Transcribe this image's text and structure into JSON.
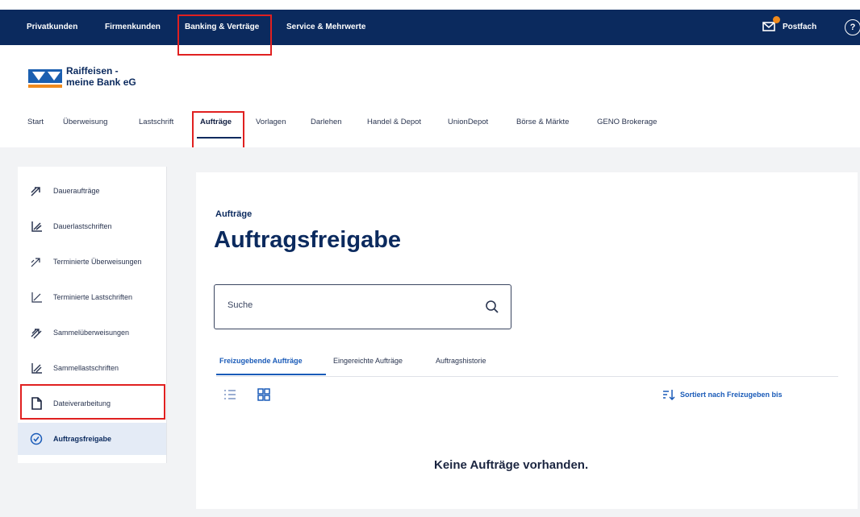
{
  "topnav": {
    "items": [
      "Privatkunden",
      "Firmenkunden",
      "Banking & Verträge",
      "Service & Mehrwerte"
    ],
    "postfach_label": "Postfach",
    "help_symbol": "?"
  },
  "logo": {
    "line1": "Raiffeisen -",
    "line2": "meine Bank eG",
    "icon": "volksbank-raiffeisen-logo"
  },
  "subnav": {
    "items": [
      "Start",
      "Überweisung",
      "Lastschrift",
      "Aufträge",
      "Vorlagen",
      "Darlehen",
      "Handel & Depot",
      "UnionDepot",
      "Börse & Märkte",
      "GENO Brokerage"
    ],
    "active": "Aufträge"
  },
  "sidebar": {
    "items": [
      {
        "label": "Daueraufträge",
        "icon": "standing-order-icon"
      },
      {
        "label": "Dauerlastschriften",
        "icon": "standing-debit-icon"
      },
      {
        "label": "Terminierte Überweisungen",
        "icon": "scheduled-transfer-icon"
      },
      {
        "label": "Terminierte Lastschriften",
        "icon": "scheduled-debit-icon"
      },
      {
        "label": "Sammelüberweisungen",
        "icon": "batch-transfer-icon"
      },
      {
        "label": "Sammellastschriften",
        "icon": "batch-debit-icon"
      },
      {
        "label": "Dateiverarbeitung",
        "icon": "file-icon"
      },
      {
        "label": "Auftragsfreigabe",
        "icon": "check-circle-icon"
      }
    ],
    "active": "Auftragsfreigabe"
  },
  "main": {
    "breadcrumb": "Aufträge",
    "title": "Auftragsfreigabe",
    "search": {
      "placeholder": "Suche",
      "icon": "search-icon"
    },
    "tabs": [
      "Freizugebende Aufträge",
      "Eingereichte Aufträge",
      "Auftragshistorie"
    ],
    "active_tab": "Freizugebende Aufträge",
    "sort_label": "Sortiert nach Freizugeben bis",
    "empty_message": "Keine Aufträge vorhanden."
  },
  "colors": {
    "nav_bg": "#0b2a5e",
    "accent": "#1a5bb8",
    "highlight_box": "#e02020",
    "badge": "#f08a1c"
  }
}
